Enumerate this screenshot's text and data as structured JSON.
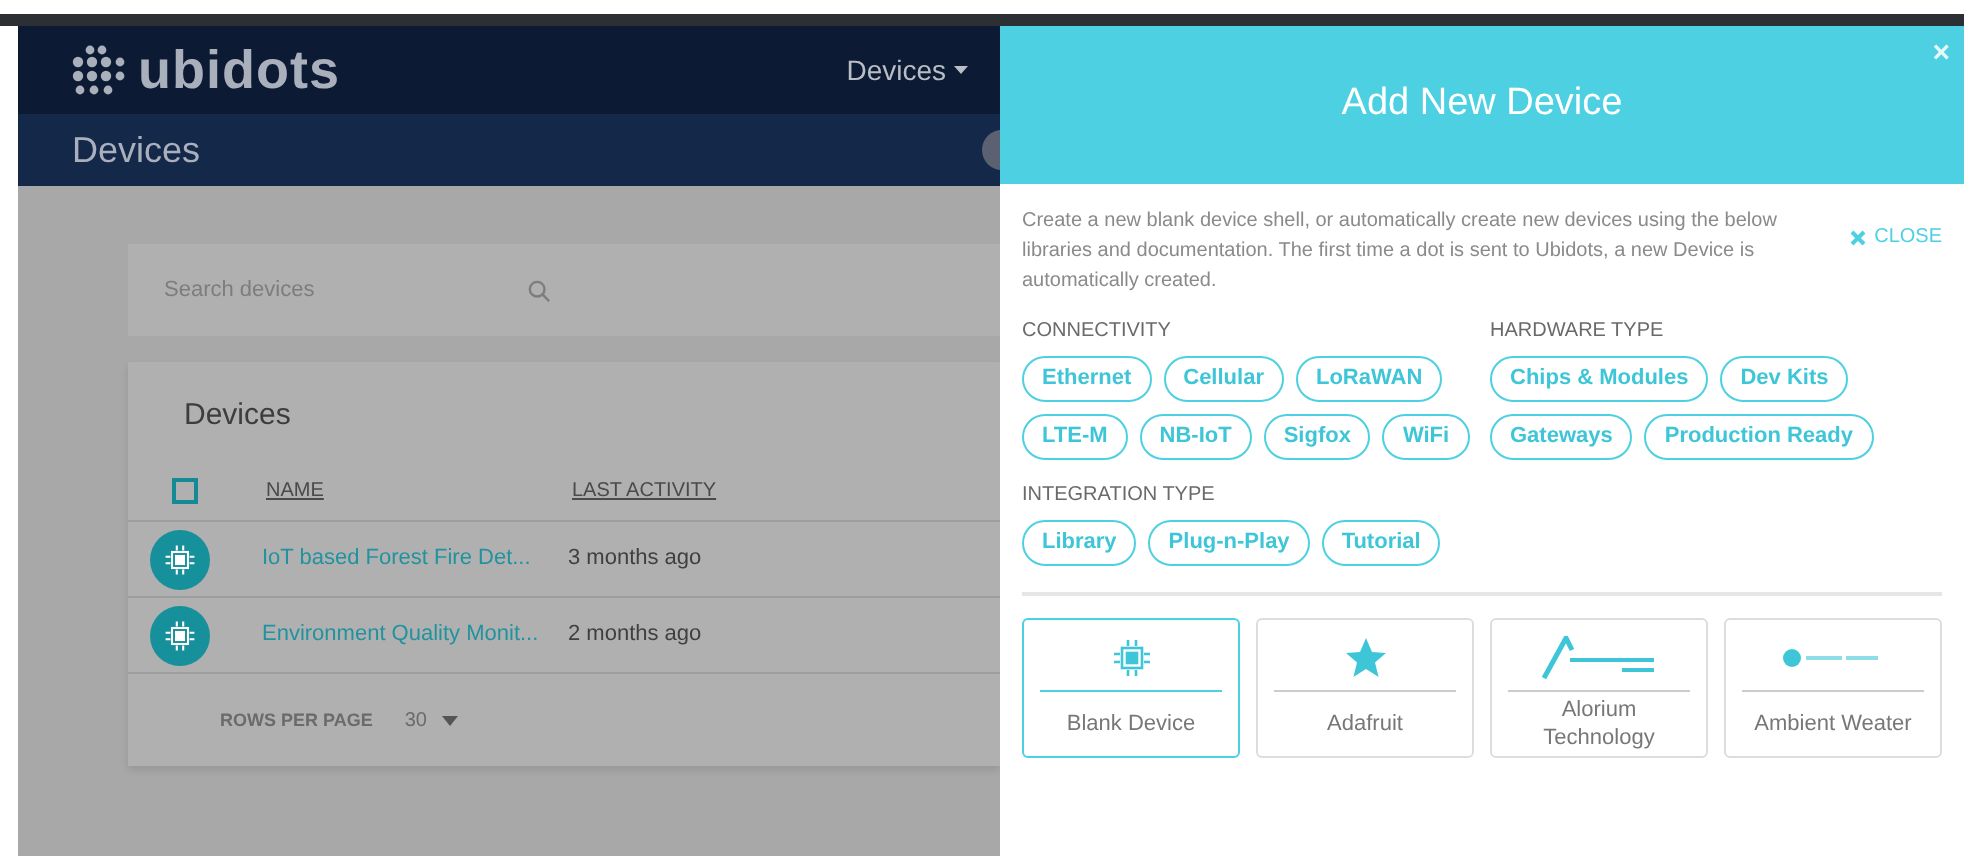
{
  "navbar": {
    "logo": "ubidots",
    "menu": "Devices"
  },
  "subheader": {
    "title": "Devices"
  },
  "search": {
    "placeholder": "Search devices"
  },
  "devices_card": {
    "title": "Devices",
    "select_all": {
      "checked": false
    },
    "columns": [
      "NAME",
      "LAST ACTIVITY"
    ],
    "rows": [
      {
        "name": "IoT based Forest Fire Det...",
        "last_activity": "3 months ago"
      },
      {
        "name": "Environment Quality Monit...",
        "last_activity": "2 months ago"
      }
    ],
    "rows_per_page": {
      "label": "ROWS PER PAGE",
      "value": "30"
    }
  },
  "drawer": {
    "close_icon": "×",
    "title": "Add New Device",
    "description": "Create a new blank device shell, or automatically create new devices using the below libraries and documentation. The first time a dot is sent to Ubidots, a new Device is automatically created.",
    "close": "CLOSE",
    "filter_groups": [
      {
        "title": "CONNECTIVITY",
        "tags": [
          "Ethernet",
          "Cellular",
          "LoRaWAN",
          "LTE-M",
          "NB-IoT",
          "Sigfox",
          "WiFi"
        ]
      },
      {
        "title": "HARDWARE TYPE",
        "tags": [
          "Chips & Modules",
          "Dev Kits",
          "Gateways",
          "Production Ready"
        ]
      },
      {
        "title": "INTEGRATION TYPE",
        "tags": [
          "Library",
          "Plug-n-Play",
          "Tutorial"
        ]
      }
    ],
    "integrations": [
      {
        "kind": "chip",
        "label": "Blank Device",
        "selected": true
      },
      {
        "kind": "star",
        "label": "Adafruit",
        "selected": false
      },
      {
        "kind": "alorium",
        "label": "Alorium Technology",
        "selected": false
      },
      {
        "kind": "ambient",
        "label": "Ambient Weater",
        "selected": false
      }
    ]
  }
}
